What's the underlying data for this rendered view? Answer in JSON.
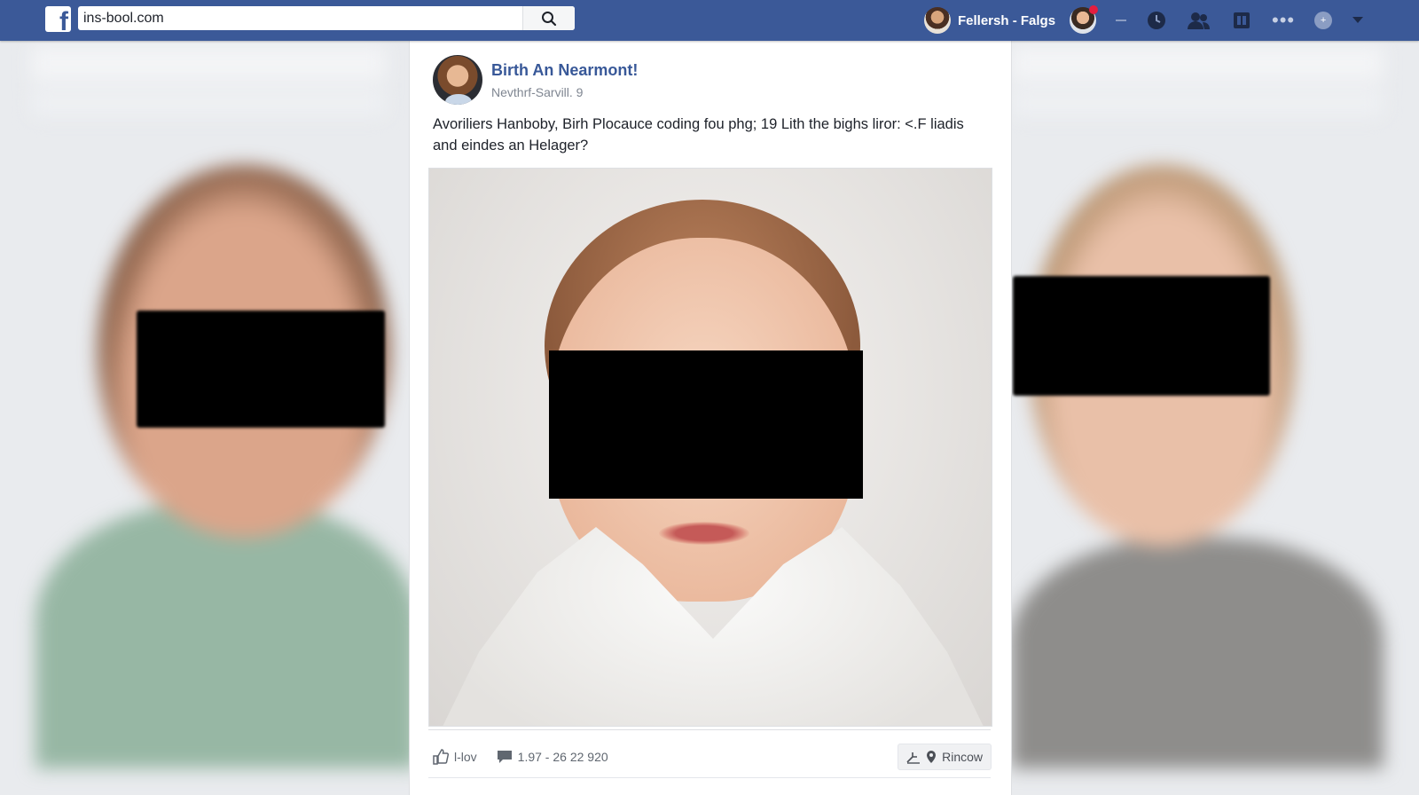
{
  "topbar": {
    "logo": "f",
    "search_value": "ins-bool.com",
    "search_icon": "search-icon",
    "user_name": "Fellersh - Falgs",
    "icons": [
      "avatar",
      "dash",
      "clock-icon",
      "friends-icon",
      "messages-icon",
      "more-icon",
      "plus-icon",
      "chevron-down-icon"
    ],
    "more_label": "•••",
    "plus_label": "+"
  },
  "post": {
    "author": "Birth An Nearmont!",
    "timestamp": "Nevthrf-Sarvill. 9",
    "text": "Avoriliers Hanboby, Birh Plocauce coding fou phg; 19 Lith the bighs liror: <.F liadis and eindes an Helager?",
    "actions": {
      "like_label": "l-lov",
      "comment_label": "1.97 - 26 22 920",
      "share_label": "Rincow"
    }
  },
  "colors": {
    "brand": "#3b5998",
    "link": "#385898",
    "background": "#e9ebee"
  }
}
